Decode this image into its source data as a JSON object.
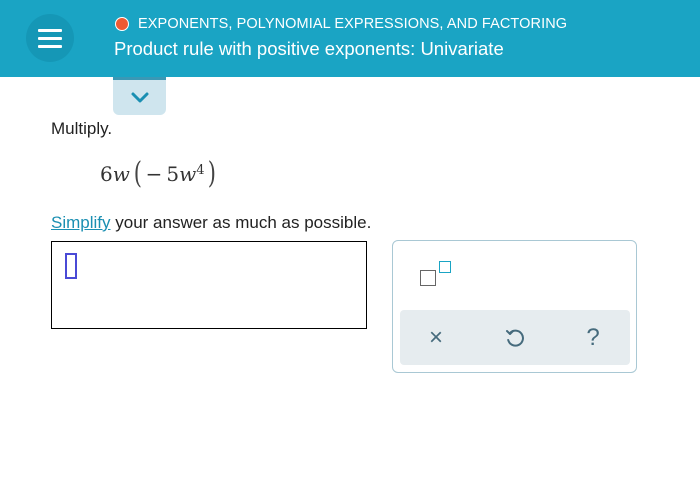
{
  "header": {
    "topic": "EXPONENTS, POLYNOMIAL EXPRESSIONS, AND FACTORING",
    "title": "Product rule with positive exponents: Univariate",
    "colors": {
      "bar": "#1aa4c4",
      "status_dot": "#ef5a33"
    },
    "icons": {
      "menu": "hamburger-menu-icon",
      "status": "status-dot-icon",
      "expand": "chevron-down-icon"
    }
  },
  "problem": {
    "instruction": "Multiply.",
    "expression": {
      "coef1": "6",
      "var1": "w",
      "open_paren": "(",
      "coef2": "− 5",
      "var2": "w",
      "exponent": "4",
      "close_paren": ")"
    },
    "simplify_link": "Simplify",
    "simplify_rest": " your answer as much as possible."
  },
  "answer": {
    "value": ""
  },
  "tools": {
    "template_icon": "exponent-template-icon",
    "clear_label": "×",
    "undo_label": "↺",
    "help_label": "?"
  }
}
